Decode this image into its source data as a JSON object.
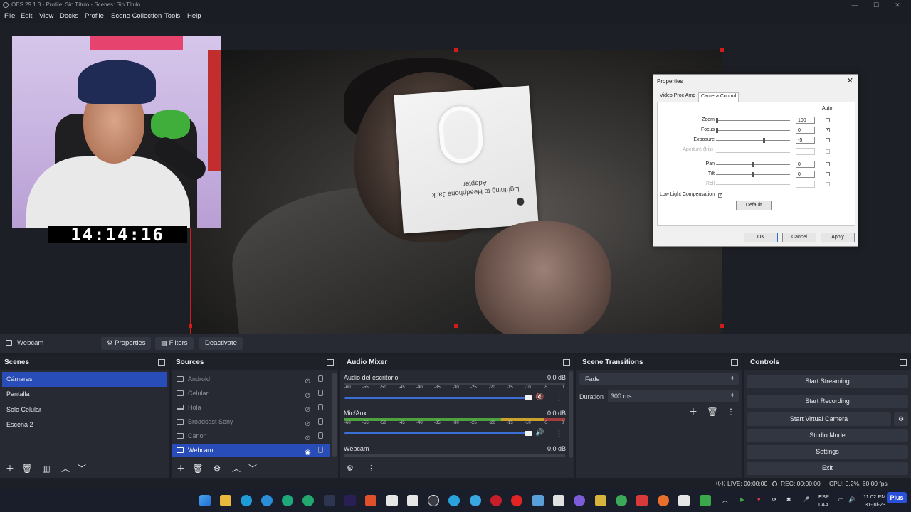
{
  "window": {
    "title": "OBS 29.1.3 - Profile: Sin Título - Scenes: Sin Título",
    "controls": [
      "—",
      "☐",
      "✕"
    ]
  },
  "menu": [
    "File",
    "Edit",
    "View",
    "Docks",
    "Profile",
    "Scene Collection",
    "Tools",
    "Help"
  ],
  "preview": {
    "overlay_clock": "14:14:16",
    "box_text": "Lightning to Headphone Jack Adapter"
  },
  "properties_dialog": {
    "title": "Properties",
    "tabs": [
      "Video Proc Amp",
      "Camera Control"
    ],
    "active_tab": "Camera Control",
    "auto_header": "Auto",
    "rows": [
      {
        "label": "Zoom",
        "value": "100",
        "enabled": true,
        "auto": false
      },
      {
        "label": "Focus",
        "value": "0",
        "enabled": true,
        "auto": true
      },
      {
        "label": "Exposure",
        "value": "-5",
        "enabled": true,
        "auto": false
      },
      {
        "label": "Aperture (Iris)",
        "value": "",
        "enabled": false,
        "auto": false
      },
      {
        "label": "Pan",
        "value": "0",
        "enabled": true,
        "auto": false
      },
      {
        "label": "Tilt",
        "value": "0",
        "enabled": true,
        "auto": false
      },
      {
        "label": "Roll",
        "value": "",
        "enabled": false,
        "auto": false
      }
    ],
    "low_light_label": "Low Light Compensation",
    "low_light_checked": true,
    "default_button": "Default",
    "ok": "OK",
    "cancel": "Cancel",
    "apply": "Apply"
  },
  "source_bar": {
    "selected_source": "Webcam",
    "properties": "Properties",
    "filters": "Filters",
    "deactivate": "Deactivate"
  },
  "scenes": {
    "title": "Scenes",
    "items": [
      "Cámaras",
      "Pantalla",
      "Solo Celular",
      "Escena 2"
    ],
    "selected": 0
  },
  "sources": {
    "title": "Sources",
    "items": [
      "Android",
      "Celular",
      "Hola",
      "Broadcast Sony",
      "Canon",
      "Webcam"
    ],
    "selected": 5
  },
  "audio_mixer": {
    "title": "Audio Mixer",
    "ticks": [
      "-60",
      "-55",
      "-50",
      "-45",
      "-40",
      "-35",
      "-30",
      "-25",
      "-20",
      "-15",
      "-10",
      "-5",
      "0"
    ],
    "channels": [
      {
        "name": "Audio del escritorio",
        "db": "0.0 dB",
        "muted": true,
        "level": 0
      },
      {
        "name": "Mic/Aux",
        "db": "0.0 dB",
        "muted": false,
        "level": 0.9
      },
      {
        "name": "Webcam",
        "db": "0.0 dB",
        "muted": false,
        "level": 0
      }
    ]
  },
  "scene_transitions": {
    "title": "Scene Transitions",
    "transition": "Fade",
    "duration_label": "Duration",
    "duration_value": "300 ms"
  },
  "controls": {
    "title": "Controls",
    "buttons": [
      "Start Streaming",
      "Start Recording",
      "Start Virtual Camera",
      "Studio Mode",
      "Settings",
      "Exit"
    ]
  },
  "status": {
    "live": "LIVE: 00:00:00",
    "rec": "REC: 00:00:00",
    "cpu": "CPU: 0.2%, 60.00 fps"
  },
  "taskbar": {
    "language": "ESP",
    "layout": "LAA",
    "time": "11:02 PM",
    "date": "31-jul-23",
    "badge": "Plus"
  },
  "colors": {
    "accent": "#284cb8",
    "selection_border": "#d21c1c",
    "meter_green": "#4ca23c",
    "meter_yellow": "#c9a22c"
  }
}
